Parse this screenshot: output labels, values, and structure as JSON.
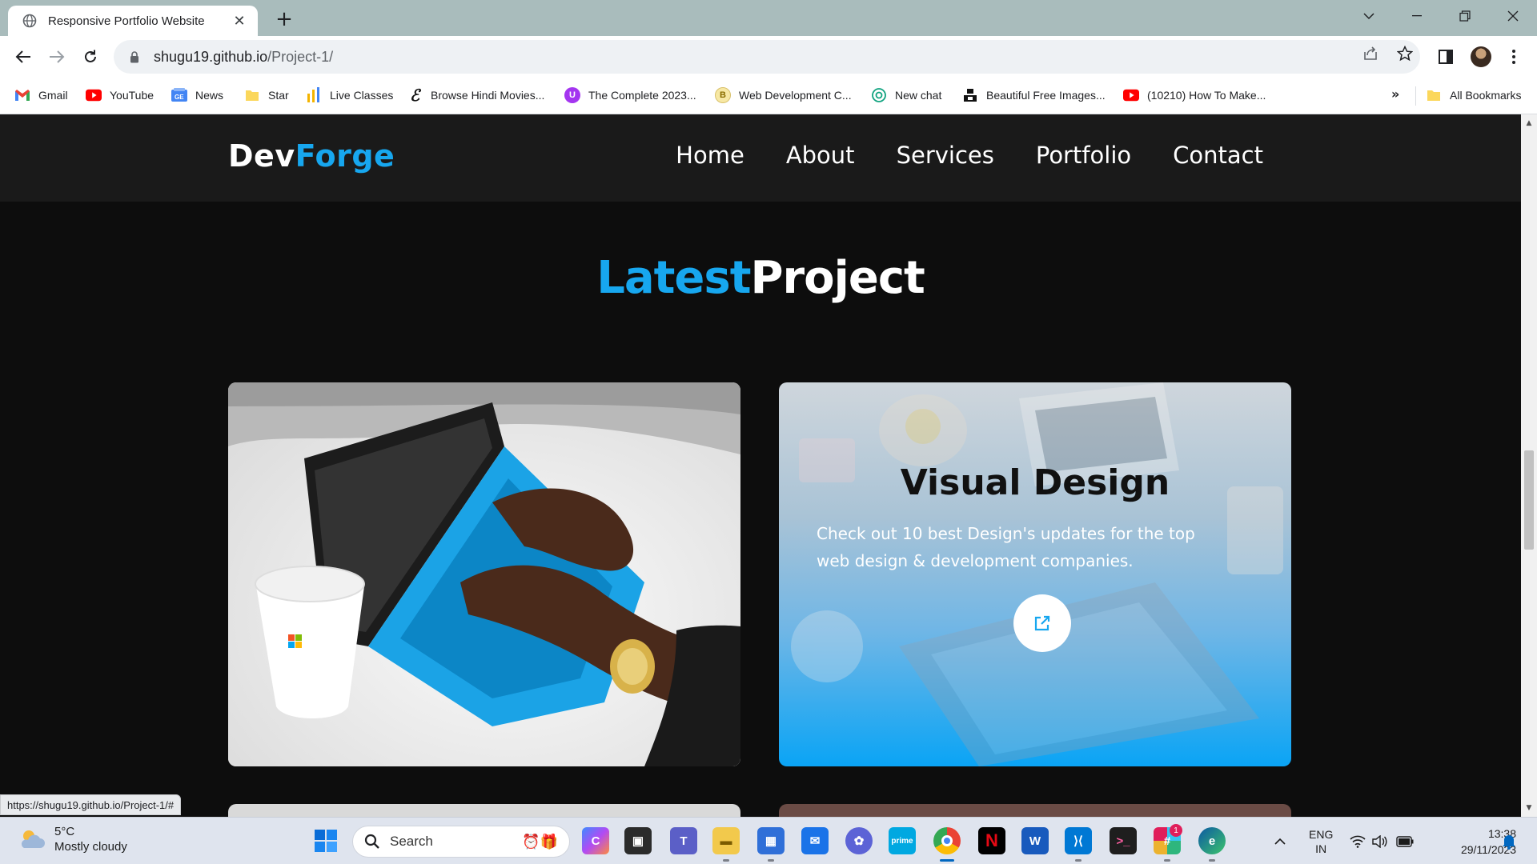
{
  "browser": {
    "tab_title": "Responsive Portfolio Website",
    "tab_close": "✕",
    "new_tab": "+",
    "url_host": "shugu19.github.io",
    "url_path": "/Project-1/",
    "status_url": "https://shugu19.github.io/Project-1/#"
  },
  "bookmarks": {
    "items": [
      {
        "label": "Gmail",
        "icon": "gmail-icon"
      },
      {
        "label": "YouTube",
        "icon": "youtube-icon"
      },
      {
        "label": "News",
        "icon": "news-icon"
      },
      {
        "label": "Star",
        "icon": "folder-icon"
      },
      {
        "label": "Live Classes",
        "icon": "bar-chart-icon"
      },
      {
        "label": "Browse Hindi Movies...",
        "icon": "script-e-icon"
      },
      {
        "label": "The Complete 2023...",
        "icon": "udemy-icon"
      },
      {
        "label": "Web Development C...",
        "icon": "coin-icon"
      },
      {
        "label": "New chat",
        "icon": "openai-icon"
      },
      {
        "label": "Beautiful Free Images...",
        "icon": "unsplash-icon"
      },
      {
        "label": "(10210) How To Make...",
        "icon": "youtube-icon"
      }
    ],
    "more": "»",
    "all_bookmarks": "All Bookmarks"
  },
  "site": {
    "logo_main": "Dev",
    "logo_accent": "Forge",
    "nav": [
      "Home",
      "About",
      "Services",
      "Portfolio",
      "Contact"
    ],
    "section_title_accent": "Latest",
    "section_title_main": "Project",
    "card": {
      "title": "Visual Design",
      "text": "Check out 10 best Design's updates for the top web design & development companies."
    }
  },
  "taskbar": {
    "weather_temp": "5°C",
    "weather_desc": "Mostly cloudy",
    "search_label": "Search",
    "lang_top": "ENG",
    "lang_bottom": "IN",
    "time": "13:38",
    "date": "29/11/2023",
    "slack_badge": "1"
  },
  "colors": {
    "accent": "#17a7ef",
    "header_bg": "#1a1a1a",
    "page_bg": "#0d0d0d"
  }
}
